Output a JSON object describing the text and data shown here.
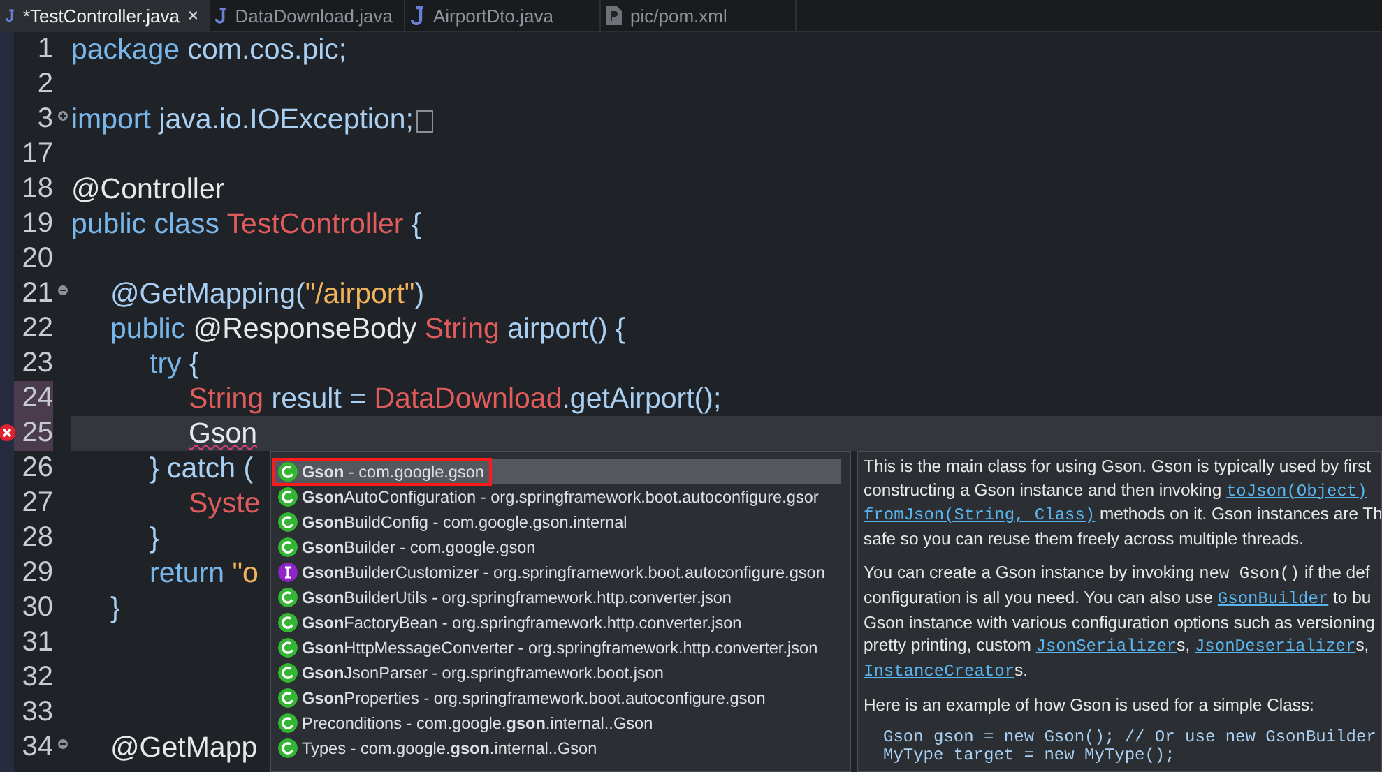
{
  "tabs": [
    {
      "label": "*TestController.java",
      "kind": "java",
      "selected": true
    },
    {
      "label": "DataDownload.java",
      "kind": "java",
      "selected": false
    },
    {
      "label": "AirportDto.java",
      "kind": "java",
      "selected": false
    },
    {
      "label": "pic/pom.xml",
      "kind": "xml",
      "selected": false
    }
  ],
  "code_lines": [
    {
      "number": "1",
      "tokens": [
        {
          "kind": "kw",
          "text": "package"
        },
        {
          "kind": "plain",
          "text": " com.cos.pic;"
        }
      ]
    },
    {
      "number": "2"
    },
    {
      "number": "3",
      "collapsible": true,
      "collapsed": true,
      "tokens": [
        {
          "kind": "kw",
          "text": "import"
        },
        {
          "kind": "plain",
          "text": " java.io.IOException;"
        }
      ]
    },
    {
      "number": "17"
    },
    {
      "number": "18",
      "tokens": [
        {
          "kind": "annot",
          "text": "@Controller"
        }
      ]
    },
    {
      "number": "19",
      "tokens": [
        {
          "kind": "kw",
          "text": "public class "
        },
        {
          "kind": "type",
          "text": "TestController"
        },
        {
          "kind": "plain",
          "text": " {"
        }
      ]
    },
    {
      "number": "20"
    },
    {
      "number": "21",
      "collapsible": true,
      "collapsed": false,
      "tokens": [
        {
          "kind": "plain",
          "text": "\t@GetMapping("
        },
        {
          "kind": "string",
          "text": "\"/airport\""
        },
        {
          "kind": "plain",
          "text": ")"
        }
      ]
    },
    {
      "number": "22",
      "tokens": [
        {
          "kind": "kw",
          "text": "\tpublic "
        },
        {
          "kind": "annot",
          "text": "@ResponseBody "
        },
        {
          "kind": "type",
          "text": "String"
        },
        {
          "kind": "plain",
          "text": " airport() {"
        }
      ]
    },
    {
      "number": "23",
      "tokens": [
        {
          "kind": "kw",
          "text": "\t\ttry"
        },
        {
          "kind": "plain",
          "text": " {"
        }
      ]
    },
    {
      "number": "24",
      "marked": true,
      "tokens": [
        {
          "kind": "type",
          "text": "\t\t\tString"
        },
        {
          "kind": "plain",
          "text": " result = "
        },
        {
          "kind": "type",
          "text": "DataDownload"
        },
        {
          "kind": "plain",
          "text": ".getAirport();"
        }
      ]
    },
    {
      "number": "25",
      "current": true,
      "error": true,
      "tokens": [
        {
          "kind": "ident",
          "text": "\t\t\tGson"
        }
      ]
    },
    {
      "number": "26",
      "tokens": [
        {
          "kind": "plain",
          "text": "\t\t} catch ("
        }
      ]
    },
    {
      "number": "27",
      "tokens": [
        {
          "kind": "type",
          "text": "\t\t\tSyste"
        }
      ]
    },
    {
      "number": "28",
      "tokens": [
        {
          "kind": "plain",
          "text": "\t\t}"
        }
      ]
    },
    {
      "number": "29",
      "tokens": [
        {
          "kind": "kw",
          "text": "\t\treturn "
        },
        {
          "kind": "string",
          "text": "\"o"
        }
      ]
    },
    {
      "number": "30",
      "tokens": [
        {
          "kind": "plain",
          "text": "\t}"
        }
      ]
    },
    {
      "number": "31"
    },
    {
      "number": "32"
    },
    {
      "number": "33"
    },
    {
      "number": "34",
      "collapsible": true,
      "collapsed": false,
      "tokens": [
        {
          "kind": "annot",
          "text": "\t@GetMapp"
        }
      ]
    }
  ],
  "completions": [
    {
      "kind": "class",
      "label": "**Gson** - com.google.gson",
      "selected": true,
      "highlighted": true
    },
    {
      "kind": "class",
      "label": "**Gson**AutoConfiguration - org.springframework.boot.autoconfigure.gsor",
      "selected": false,
      "highlighted": false
    },
    {
      "kind": "class",
      "label": "**Gson**BuildConfig - com.google.gson.internal",
      "selected": false,
      "highlighted": false
    },
    {
      "kind": "class",
      "label": "**Gson**Builder - com.google.gson",
      "selected": false,
      "highlighted": false
    },
    {
      "kind": "interface",
      "label": "**Gson**BuilderCustomizer - org.springframework.boot.autoconfigure.gson",
      "selected": false,
      "highlighted": false
    },
    {
      "kind": "class",
      "label": "**Gson**BuilderUtils - org.springframework.http.converter.json",
      "selected": false,
      "highlighted": false
    },
    {
      "kind": "class",
      "label": "**Gson**FactoryBean - org.springframework.http.converter.json",
      "selected": false,
      "highlighted": false
    },
    {
      "kind": "class",
      "label": "**Gson**HttpMessageConverter - org.springframework.http.converter.json",
      "selected": false,
      "highlighted": false
    },
    {
      "kind": "class",
      "label": "**Gson**JsonParser - org.springframework.boot.json",
      "selected": false,
      "highlighted": false
    },
    {
      "kind": "class",
      "label": "**Gson**Properties - org.springframework.boot.autoconfigure.gson",
      "selected": false,
      "highlighted": false
    },
    {
      "kind": "class",
      "label": "Preconditions - com.google.**gson**.internal..Gson",
      "selected": false,
      "highlighted": false
    },
    {
      "kind": "class",
      "label": "Types - com.google.**gson**.internal..Gson",
      "selected": false,
      "highlighted": false
    }
  ],
  "documentation": [
    {
      "kind": "prose",
      "lines": [
        [
          {
            "kind": "text",
            "text": "This is the main class for using Gson. Gson is typically used by first"
          }
        ],
        [
          {
            "kind": "text",
            "text": "constructing a Gson instance and then invoking "
          },
          {
            "kind": "link",
            "text": "toJson(Object)"
          }
        ],
        [
          {
            "kind": "link",
            "text": "fromJson(String, Class)"
          },
          {
            "kind": "text",
            "text": " methods on it. Gson instances are Th"
          }
        ],
        [
          {
            "kind": "text",
            "text": "safe so you can reuse them freely across multiple threads."
          }
        ]
      ]
    },
    {
      "kind": "prose",
      "lines": [
        [
          {
            "kind": "text",
            "text": "You can create a Gson instance by invoking "
          },
          {
            "kind": "code",
            "text": "new Gson()"
          },
          {
            "kind": "text",
            "text": " if the def"
          }
        ],
        [
          {
            "kind": "text",
            "text": "configuration is all you need. You can also use "
          },
          {
            "kind": "link",
            "text": "GsonBuilder"
          },
          {
            "kind": "text",
            "text": " to bu"
          }
        ],
        [
          {
            "kind": "text",
            "text": "Gson instance with various configuration options such as versioning"
          }
        ],
        [
          {
            "kind": "text",
            "text": "pretty printing, custom "
          },
          {
            "kind": "link",
            "text": "JsonSerializer"
          },
          {
            "kind": "text",
            "text": "s, "
          },
          {
            "kind": "link",
            "text": "JsonDeserializer"
          },
          {
            "kind": "text",
            "text": "s,"
          }
        ],
        [
          {
            "kind": "link",
            "text": "InstanceCreator"
          },
          {
            "kind": "text",
            "text": "s."
          }
        ]
      ]
    },
    {
      "kind": "prose",
      "lines": [
        [
          {
            "kind": "text",
            "text": "Here is an example of how Gson is used for a simple Class:"
          }
        ]
      ]
    },
    {
      "kind": "code",
      "lines": [
        [
          {
            "kind": "code",
            "text": "Gson gson = new Gson(); // Or use new GsonBuilder"
          }
        ],
        [
          {
            "kind": "code",
            "text": "MyType target = new MyType();"
          }
        ]
      ]
    }
  ]
}
